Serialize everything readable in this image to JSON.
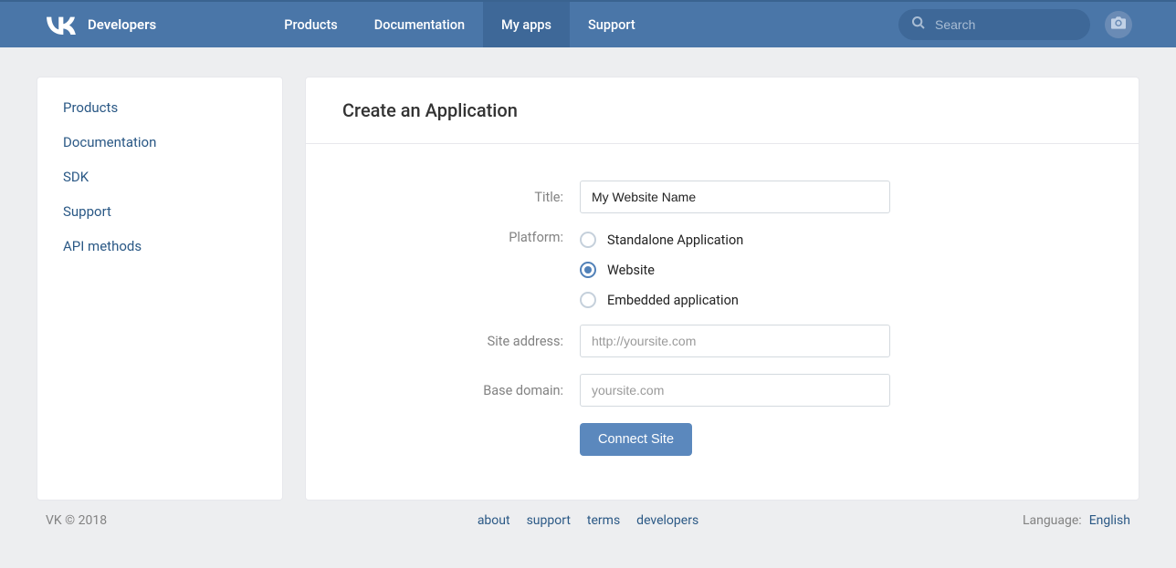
{
  "header": {
    "brand": "Developers",
    "nav": [
      {
        "label": "Products",
        "active": false
      },
      {
        "label": "Documentation",
        "active": false
      },
      {
        "label": "My apps",
        "active": true
      },
      {
        "label": "Support",
        "active": false
      }
    ],
    "search_placeholder": "Search"
  },
  "sidebar": {
    "items": [
      {
        "label": "Products"
      },
      {
        "label": "Documentation"
      },
      {
        "label": "SDK"
      },
      {
        "label": "Support"
      },
      {
        "label": "API methods"
      }
    ]
  },
  "main": {
    "title": "Create an Application",
    "form": {
      "title_label": "Title:",
      "title_value": "My Website Name",
      "platform_label": "Platform:",
      "platforms": [
        {
          "label": "Standalone Application",
          "selected": false
        },
        {
          "label": "Website",
          "selected": true
        },
        {
          "label": "Embedded application",
          "selected": false
        }
      ],
      "site_address_label": "Site address:",
      "site_address_placeholder": "http://yoursite.com",
      "site_address_value": "",
      "base_domain_label": "Base domain:",
      "base_domain_placeholder": "yoursite.com",
      "base_domain_value": "",
      "submit_label": "Connect Site"
    }
  },
  "footer": {
    "copyright": "VK © 2018",
    "links": [
      {
        "label": "about"
      },
      {
        "label": "support"
      },
      {
        "label": "terms"
      },
      {
        "label": "developers"
      }
    ],
    "language_label": "Language:",
    "language_value": "English"
  }
}
